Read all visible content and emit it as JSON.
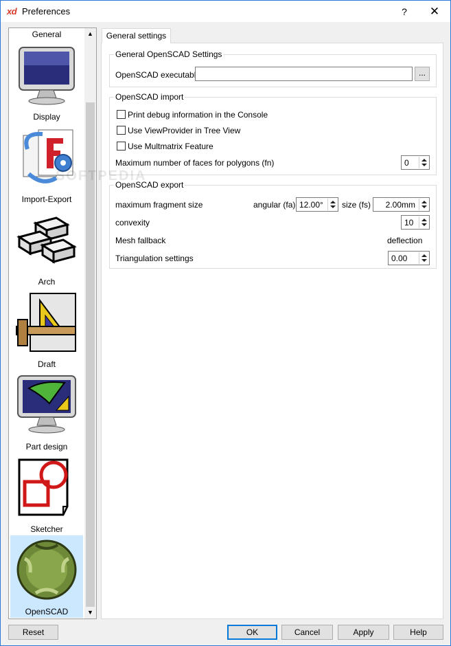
{
  "window": {
    "app_logo": "xd",
    "title": "Preferences",
    "help_label": "?",
    "close_label": "✕"
  },
  "sidebar": {
    "items": [
      {
        "label": "General",
        "icon": "general-icon"
      },
      {
        "label": "Display",
        "icon": "monitor-icon"
      },
      {
        "label": "Import-Export",
        "icon": "import-export-icon"
      },
      {
        "label": "Arch",
        "icon": "bricks-icon"
      },
      {
        "label": "Draft",
        "icon": "drafting-square-icon"
      },
      {
        "label": "Part design",
        "icon": "part-design-monitor-icon"
      },
      {
        "label": "Sketcher",
        "icon": "sketcher-icon"
      },
      {
        "label": "OpenSCAD",
        "icon": "openscad-sphere-icon",
        "selected": true
      }
    ],
    "scroll_up": "▲",
    "scroll_down": "▼"
  },
  "tab": {
    "label": "General settings"
  },
  "general_group": {
    "title": "General OpenSCAD Settings",
    "executable_label": "OpenSCAD executable",
    "executable_value": "",
    "browse_label": "..."
  },
  "import_group": {
    "title": "OpenSCAD import",
    "print_debug": {
      "label": "Print debug information in the Console",
      "checked": false
    },
    "use_viewprovider": {
      "label": "Use ViewProvider in Tree View",
      "checked": false
    },
    "use_multmatrix": {
      "label": "Use Multmatrix Feature",
      "checked": false
    },
    "max_faces_label": "Maximum number of faces for polygons (fn)",
    "max_faces_value": "0"
  },
  "export_group": {
    "title": "OpenSCAD export",
    "max_fragment_label": "maximum fragment size",
    "angular_label": "angular (fa)",
    "angular_value": "12.00°",
    "size_label": "size (fs)",
    "size_value": "2.00mm",
    "convexity_label": "convexity",
    "convexity_value": "10",
    "mesh_fallback_label": "Mesh fallback",
    "deflection_label": "deflection",
    "triangulation_label": "Triangulation settings",
    "triangulation_value": "0.00"
  },
  "buttons": {
    "reset": "Reset",
    "ok": "OK",
    "cancel": "Cancel",
    "apply": "Apply",
    "help": "Help"
  },
  "watermark": "SOFTPEDIA"
}
